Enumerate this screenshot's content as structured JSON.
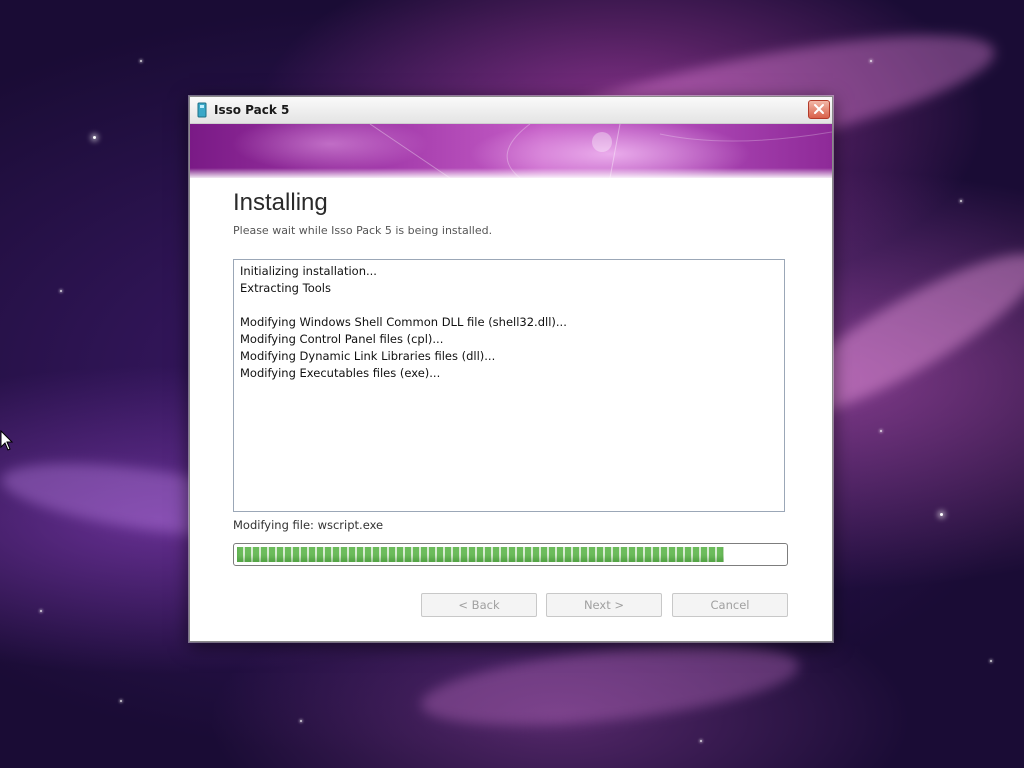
{
  "window": {
    "title": "Isso Pack 5",
    "icon": "app-icon"
  },
  "page": {
    "heading": "Installing",
    "subheading": "Please wait while Isso Pack 5 is being installed."
  },
  "log": {
    "lines": [
      "Initializing installation...",
      "Extracting Tools",
      "",
      "Modifying Windows Shell Common DLL file (shell32.dll)...",
      "Modifying Control Panel files (cpl)...",
      "Modifying Dynamic Link Libraries files (dll)...",
      "Modifying Executables files (exe)..."
    ]
  },
  "status": {
    "text": "Modifying file: wscript.exe"
  },
  "progress": {
    "fraction": 0.89
  },
  "buttons": {
    "back": "< Back",
    "next": "Next >",
    "cancel": "Cancel"
  },
  "colors": {
    "banner": "#b04ab8",
    "progress": "#6cbc5c",
    "desktop": "#3d1a6a"
  }
}
